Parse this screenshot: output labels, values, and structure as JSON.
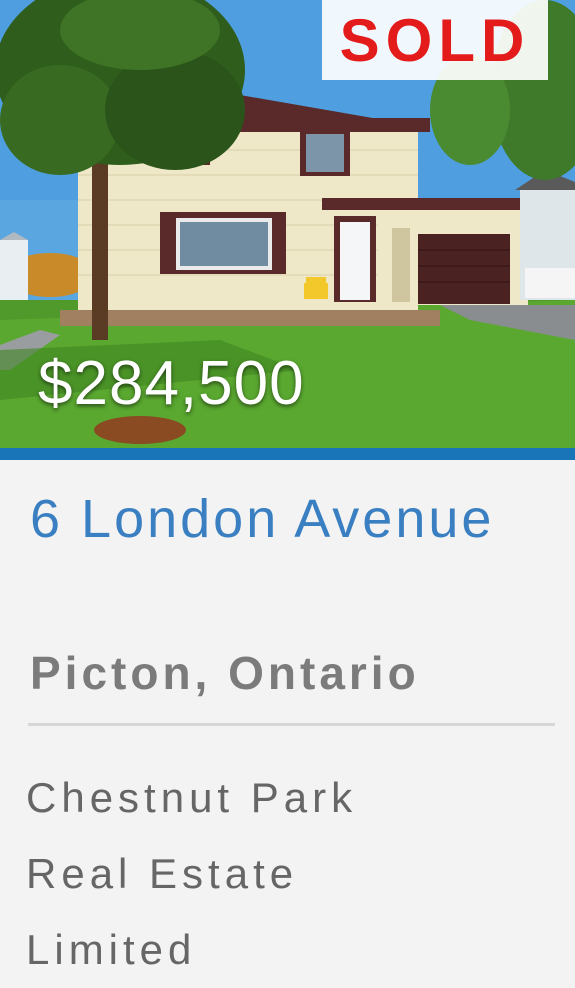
{
  "listing": {
    "status_badge": "SOLD",
    "price": "$284,500",
    "address": "6 London Avenue",
    "city": "Picton, Ontario",
    "brokerage_lines": [
      "Chestnut Park",
      "Real Estate",
      "Limited"
    ]
  },
  "photo": {
    "icon": "house-photo",
    "alt": "Two-storey house with attached garage and front lawn"
  },
  "colors": {
    "accent_blue": "#1a75b8",
    "address_blue": "#3a7fc1",
    "sold_red": "#e31b1b"
  }
}
